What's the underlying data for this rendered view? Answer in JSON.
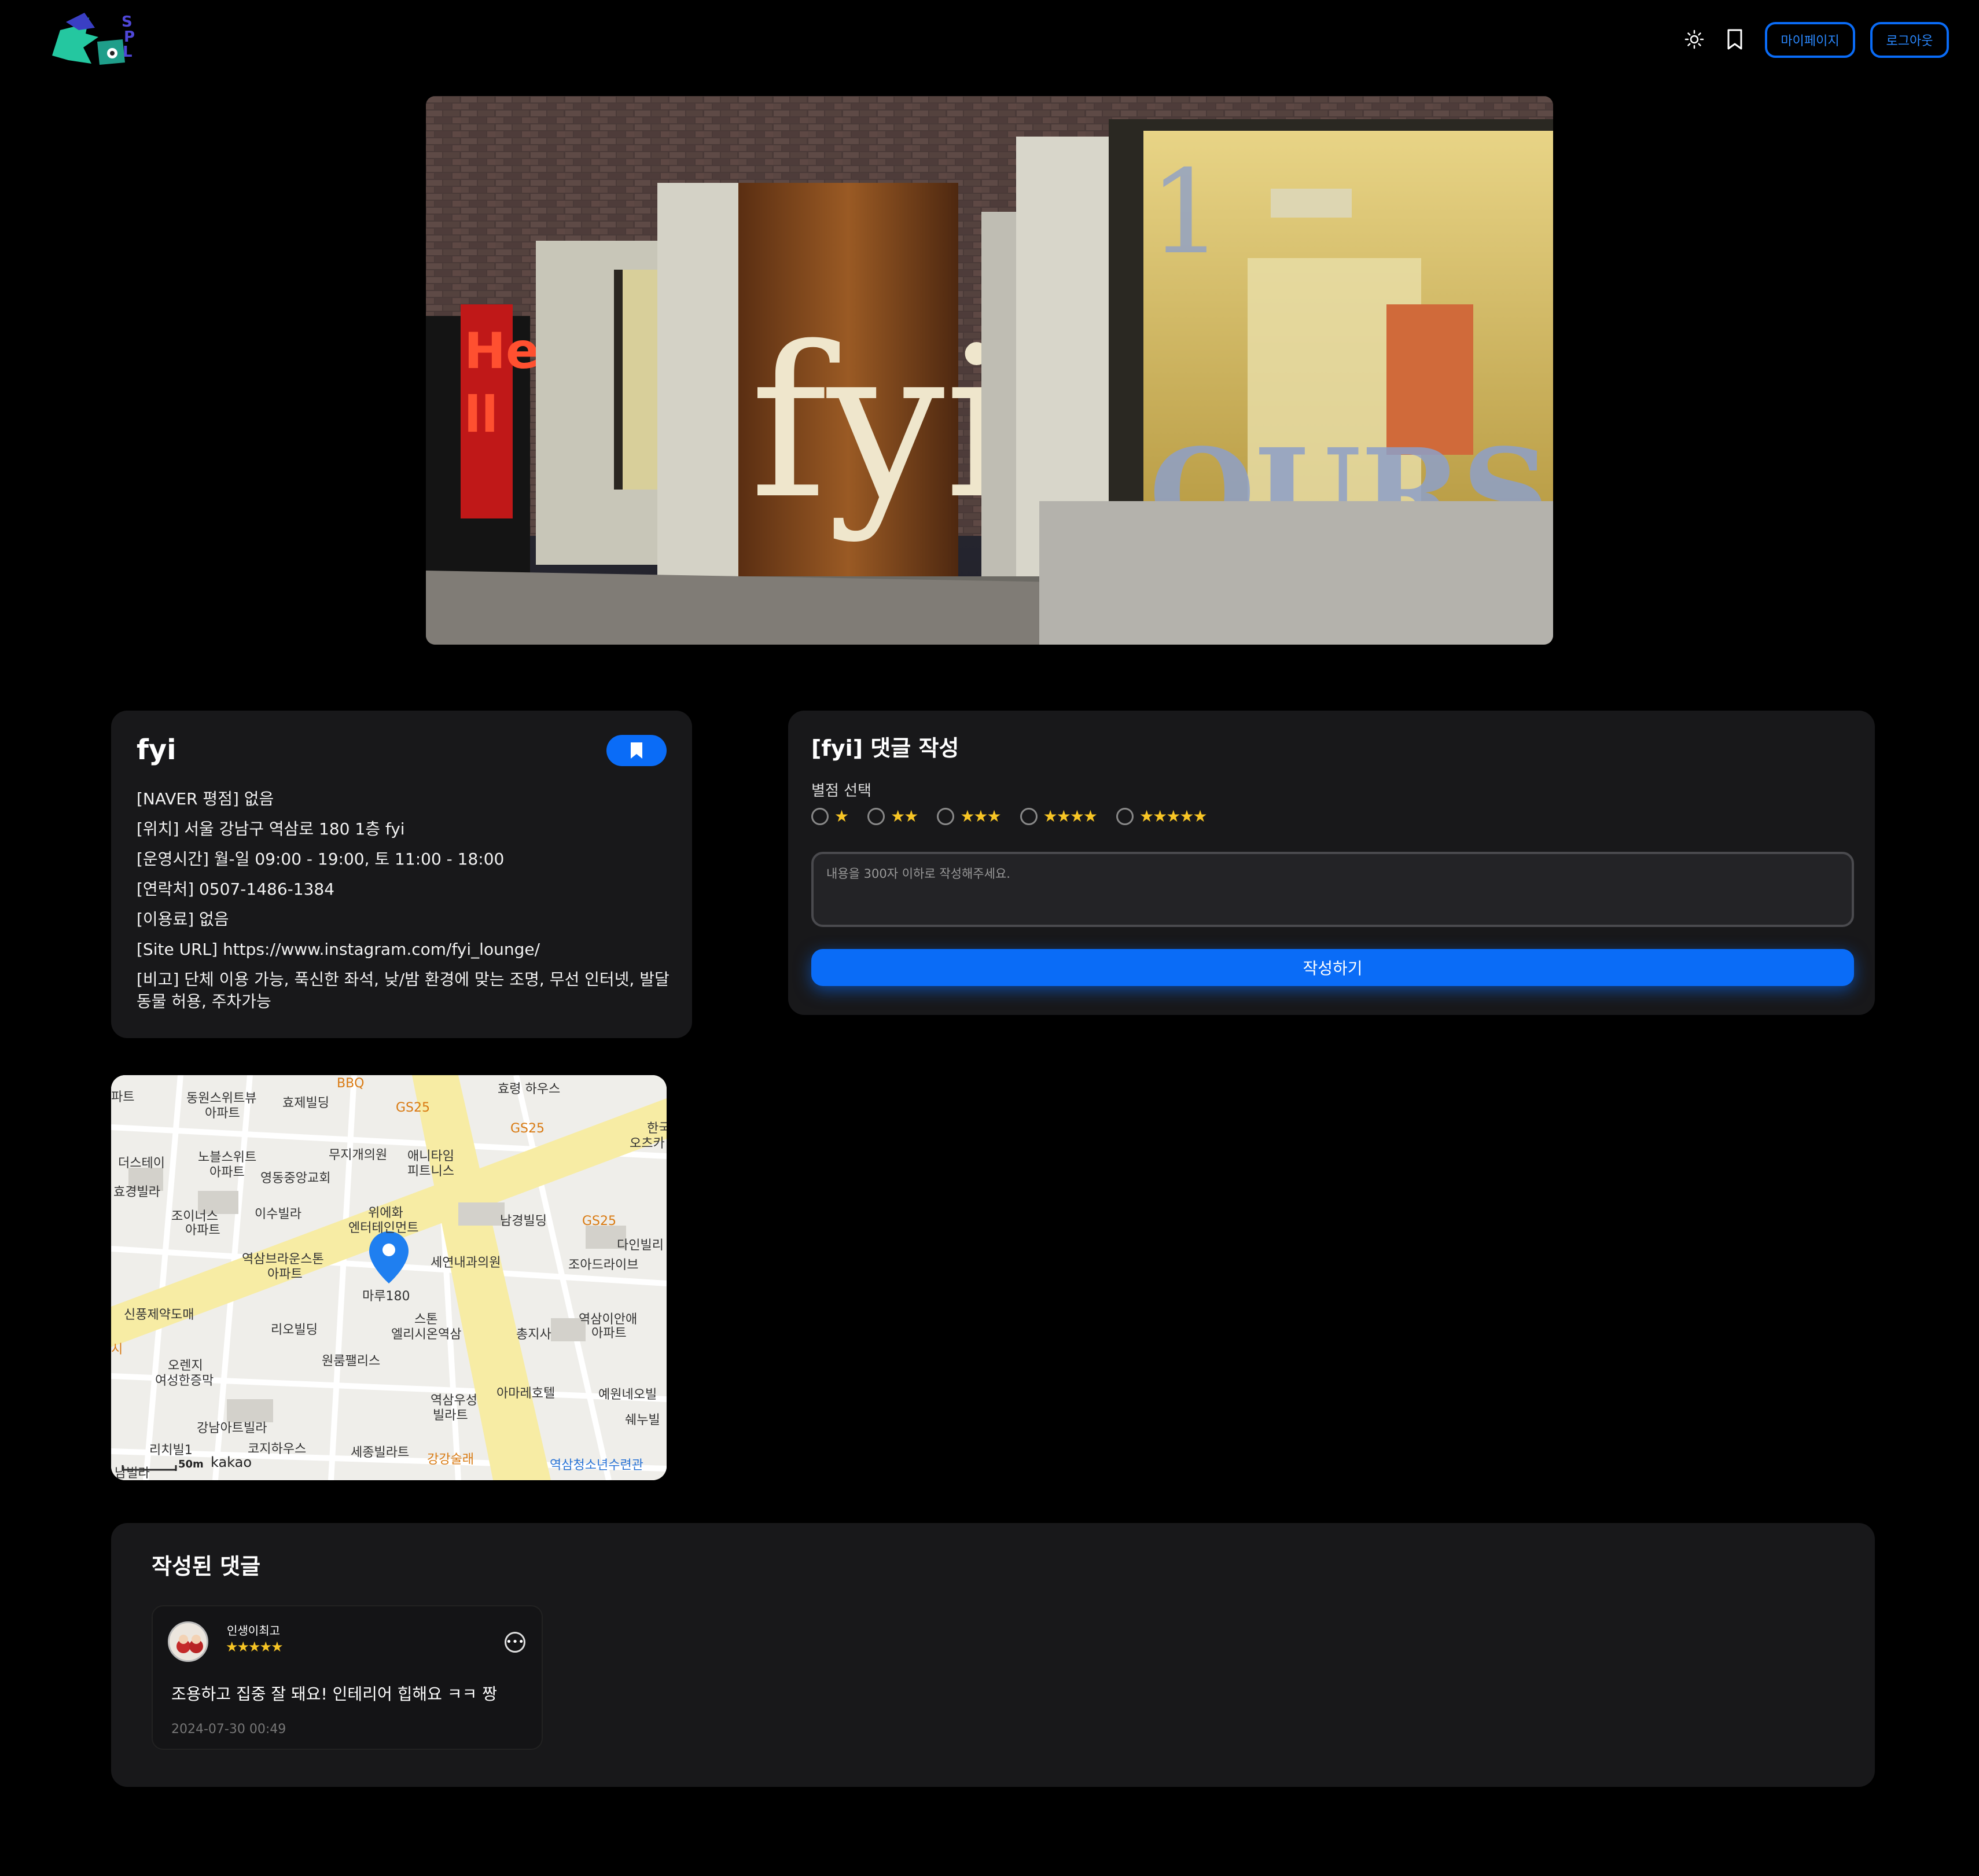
{
  "header": {
    "logo_alt": "SPOT logo",
    "theme_icon": "sun-icon",
    "bookmark_icon": "bookmark-icon",
    "mypage_label": "마이페이지",
    "logout_label": "로그아웃"
  },
  "hero": {
    "sign_text": "fyi",
    "window_text": "OURS"
  },
  "place": {
    "name": "fyi",
    "lines": [
      "[NAVER 평점] 없음",
      "[위치] 서울 강남구 역삼로 180 1층 fyi",
      "[운영시간] 월-일 09:00 - 19:00, 토 11:00 - 18:00",
      "[연락처] 0507-1486-1384",
      "[이용료] 없음",
      "[Site URL] https://www.instagram.com/fyi_lounge/",
      "[비고] 단체 이용 가능, 푹신한 좌석, 낮/밤 환경에 맞는 조명, 무선 인터넷, 발달동물 허용, 주차가능"
    ]
  },
  "map": {
    "labels": [
      "파트",
      "동원스위트뷰",
      "아파트",
      "효제빌딩",
      "BBQ",
      "GS25",
      "효령 하우스",
      "GS25",
      "한국",
      "오츠카",
      "더스테이",
      "노블스위트",
      "아파트",
      "무지개의원",
      "애니타임",
      "피트니스",
      "효경빌라",
      "영동중앙교회",
      "조이너스",
      "아파트",
      "이수빌라",
      "위에화",
      "엔터테인먼트",
      "남경빌딩",
      "GS25",
      "다인빌리",
      "역삼브라운스톤",
      "아파트",
      "세연내과의원",
      "조아드라이브",
      "마루180",
      "신풍제약도매",
      "스톤",
      "엘리시온역삼",
      "역삼이안애",
      "아파트",
      "리오빌딩",
      "총지사",
      "시",
      "오렌지",
      "여성한증막",
      "원룸팰리스",
      "아마레호텔",
      "예원네오빌",
      "역삼우성",
      "빌라트",
      "쉐누빌",
      "강남아트빌라",
      "리치빌1",
      "코지하우스",
      "세종빌라트",
      "강강술래",
      "역삼청소년수련관",
      "남빌라"
    ],
    "scale": "50m",
    "brand": "kakao"
  },
  "review_form": {
    "title": "[fyi] 댓글 작성",
    "rating_label": "별점 선택",
    "ratings": [
      "★",
      "★★",
      "★★★",
      "★★★★",
      "★★★★★"
    ],
    "placeholder": "내용을 300자 이하로 작성해주세요.",
    "submit_label": "작성하기"
  },
  "comments": {
    "title": "작성된 댓글",
    "items": [
      {
        "user": "인생이최고",
        "stars": "★★★★★",
        "body": "조용하고 집중 잘 돼요! 인테리어 힙해요 ㅋㅋ 짱",
        "date": "2024-07-30 00:49"
      }
    ]
  },
  "colors": {
    "accent": "#0a6cf7",
    "background": "#000000",
    "card": "#18181a",
    "star": "#f7c525"
  }
}
